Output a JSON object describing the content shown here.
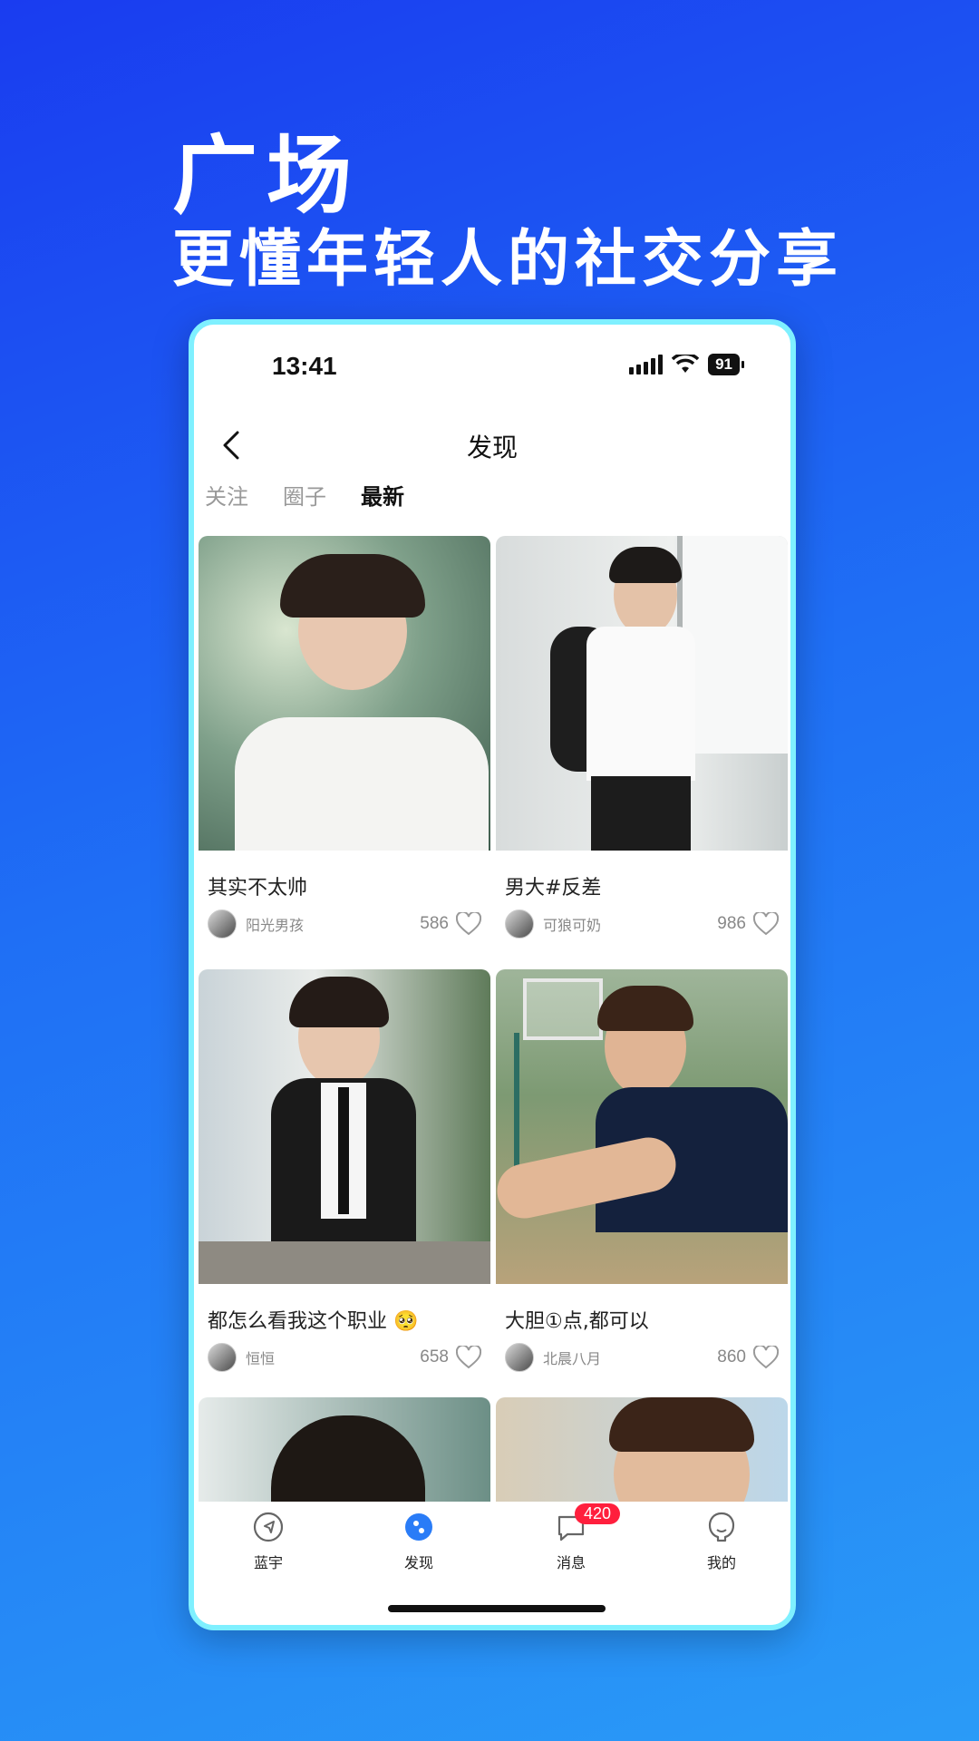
{
  "hero": {
    "title": "广场",
    "subtitle": "更懂年轻人的社交分享"
  },
  "status_bar": {
    "time": "13:41",
    "battery": "91"
  },
  "nav": {
    "title": "发现"
  },
  "tabs": [
    {
      "label": "关注",
      "active": false
    },
    {
      "label": "圈子",
      "active": false
    },
    {
      "label": "最新",
      "active": true
    }
  ],
  "posts": [
    {
      "title": "其实不太帅",
      "author": "阳光男孩",
      "likes": "586"
    },
    {
      "title": "男大#反差",
      "author": "可狼可奶",
      "likes": "986"
    },
    {
      "title": "都怎么看我这个职业 🥺",
      "author": "恒恒",
      "likes": "658"
    },
    {
      "title": "大胆①点,都可以",
      "author": "北晨八月",
      "likes": "860"
    }
  ],
  "bottom_nav": {
    "items": [
      {
        "label": "蓝宇",
        "icon": "compass-icon"
      },
      {
        "label": "发现",
        "icon": "discover-icon",
        "active": true
      },
      {
        "label": "消息",
        "icon": "message-icon",
        "badge": "420"
      },
      {
        "label": "我的",
        "icon": "profile-icon"
      }
    ]
  },
  "colors": {
    "accent": "#2a7cf7",
    "badge": "#ff1f3d",
    "frame": "#7ff0ff"
  }
}
